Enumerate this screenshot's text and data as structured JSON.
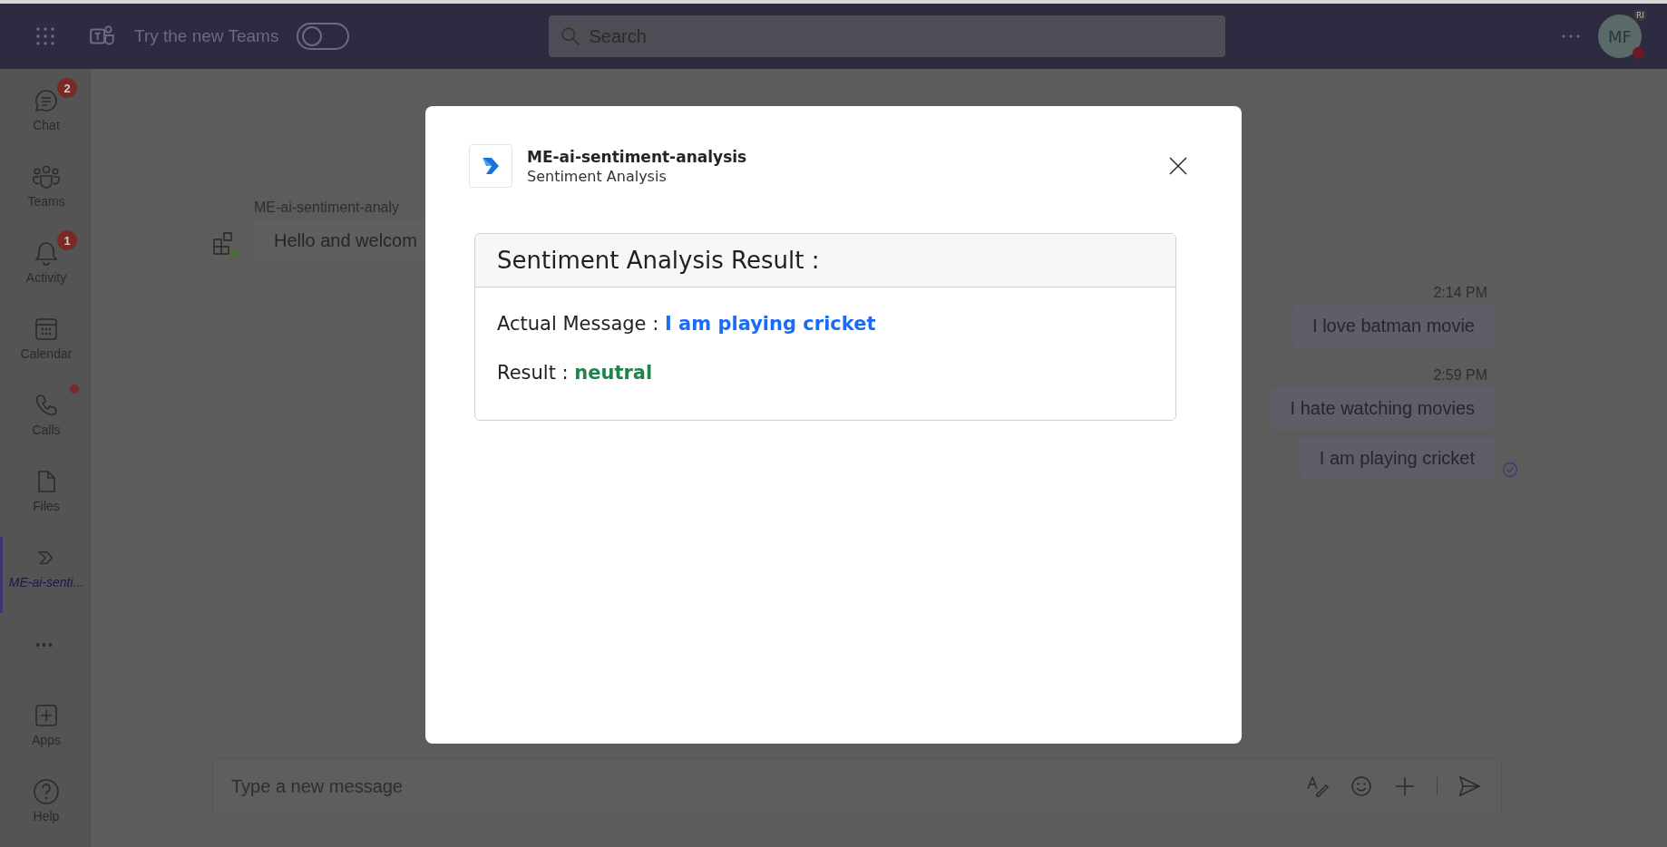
{
  "top_bar": {
    "promo": "Try the new Teams",
    "new_teams_toggle": {
      "on": false
    },
    "search": {
      "placeholder": "Search"
    },
    "avatar": {
      "initials": "MF",
      "badge": "RI"
    }
  },
  "sidebar": {
    "items": [
      {
        "kind": "chat",
        "label": "Chat",
        "badge": "2",
        "dot": false,
        "selected": false
      },
      {
        "kind": "teams",
        "label": "Teams",
        "dot": false,
        "selected": false
      },
      {
        "kind": "activity",
        "label": "Activity",
        "badge": "1",
        "dot": false,
        "selected": false
      },
      {
        "kind": "calendar",
        "label": "Calendar",
        "dot": false,
        "selected": false
      },
      {
        "kind": "calls",
        "label": "Calls",
        "dot": true,
        "selected": false
      },
      {
        "kind": "files",
        "label": "Files",
        "dot": false,
        "selected": false
      },
      {
        "kind": "app",
        "label": "ME-ai-senti...",
        "dot": false,
        "selected": true
      }
    ],
    "more": "•••",
    "bottom_items": [
      {
        "kind": "apps",
        "label": "Apps"
      },
      {
        "kind": "help",
        "label": "Help"
      }
    ]
  },
  "chat": {
    "incoming": {
      "sender": "ME-ai-sentiment-analy",
      "text": "Hello and welcom"
    },
    "outgoing": [
      {
        "time": "2:14 PM",
        "text": "I love batman movie",
        "read": false
      },
      {
        "time": "2:59 PM",
        "text": "I hate watching movies",
        "read": false
      },
      {
        "text": "I am playing cricket",
        "read": true
      }
    ]
  },
  "composer": {
    "placeholder": "Type a new message"
  },
  "dialog": {
    "title": "ME-ai-sentiment-analysis",
    "subtitle": "Sentiment Analysis",
    "card": {
      "heading": "Sentiment Analysis Result :",
      "fields": [
        {
          "kind": "message",
          "label": "Actual Message :",
          "value": "I am playing cricket"
        },
        {
          "kind": "sentiment",
          "label": "Result :",
          "value": "neutral"
        }
      ]
    }
  }
}
